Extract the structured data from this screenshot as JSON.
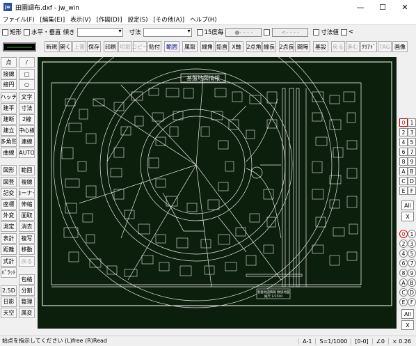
{
  "window": {
    "icon_text": "jw",
    "title": "田園調布.dxf - jw_win",
    "minimize": "—",
    "maximize": "☐",
    "close": "✕"
  },
  "menu": [
    "ファイル(F)",
    "[編集(E)]",
    "表示(V)",
    "[作図(D)]",
    "設定(S)",
    "[その他(A)]",
    "ヘルプ(H)"
  ],
  "options": {
    "rect": "矩形",
    "hv": "水平・垂直",
    "tilt": "傾き",
    "dim": "寸法",
    "deg15": "15度毎",
    "dimval": "寸法値",
    "lt": "<"
  },
  "toolbar": [
    "新規",
    "開く",
    "上書",
    "保存",
    "印刷",
    "切取",
    "コピー",
    "貼付",
    "範囲",
    "属取",
    "線角",
    "鉛直",
    "X軸",
    "2点角",
    "線長",
    "2点長",
    "間隔",
    "基設",
    "戻る",
    "進む",
    "ｸﾘｱﾄﾞ",
    "TAG",
    "画像"
  ],
  "toolbar_disabled": [
    2,
    5,
    6,
    18,
    19,
    21
  ],
  "left_tools": [
    [
      "点",
      "/"
    ],
    [
      "接線",
      "□"
    ],
    [
      "接円",
      "○"
    ],
    [
      "ハッチ",
      "文字"
    ],
    [
      "建平",
      "寸法"
    ],
    [
      "建断",
      "2線"
    ],
    [
      "建立",
      "中心線"
    ],
    [
      "多角形",
      "連線"
    ],
    [
      "曲線",
      "AUTO"
    ],
    [
      "図形",
      "範囲"
    ],
    [
      "図登",
      "複線"
    ],
    [
      "記変",
      "コーナー"
    ],
    [
      "座標",
      "伸縮"
    ],
    [
      "外変",
      "面取"
    ],
    [
      "測定",
      "消去"
    ],
    [
      "表計",
      "複写"
    ],
    [
      "距離",
      "移動"
    ],
    [
      "式計",
      "戻る"
    ],
    [
      "ﾊﾟﾗｯﾄ",
      ""
    ],
    [
      "",
      "包絡"
    ],
    [
      "2.5D",
      "分割"
    ],
    [
      "日影",
      "整理"
    ],
    [
      "天空",
      "属変"
    ]
  ],
  "layers": [
    "0",
    "1",
    "2",
    "3",
    "4",
    "5",
    "6",
    "7",
    "8",
    "9",
    "A",
    "B",
    "C",
    "D",
    "E",
    "F"
  ],
  "layer_groups": [
    "0",
    "1",
    "2",
    "3",
    "4",
    "5",
    "6",
    "7",
    "8",
    "9",
    "A",
    "B",
    "C",
    "D",
    "E",
    "F"
  ],
  "all_label": "All",
  "x_label": "X",
  "drawing": {
    "title": "基盤地図情報",
    "stamp1": "基盤地図情報 数値地図",
    "stamp2": "縮尺 1/2500"
  },
  "status": {
    "message": "始点を指示してください (L)free (R)Read",
    "paper": "A-1",
    "scale": "S=1/1000",
    "group": "[0-0]",
    "angle": "∠0",
    "zoom": "× 0.26"
  },
  "colors": {
    "canvas": "#0c1f0c",
    "lines": "#e8e8e8",
    "layer_active": "#c00000"
  }
}
